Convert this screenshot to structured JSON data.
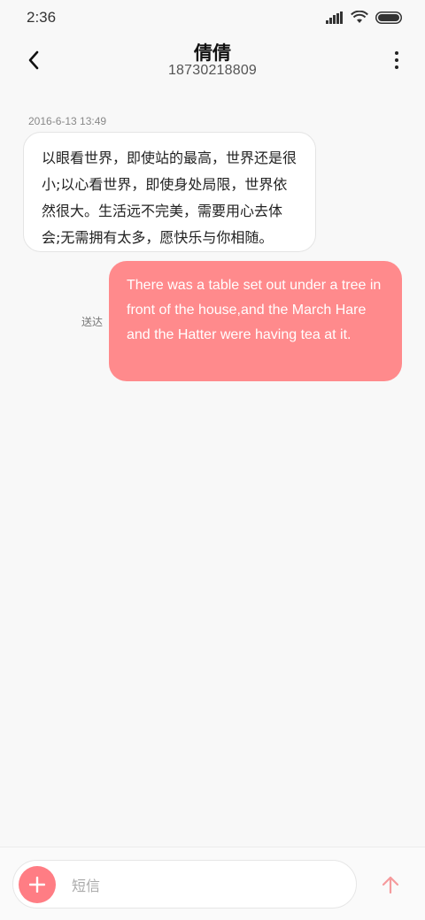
{
  "status": {
    "time": "2:36"
  },
  "header": {
    "name": "倩倩",
    "number": "18730218809"
  },
  "messages": {
    "timestamp": "2016-6-13 13:49",
    "incoming_text": "以眼看世界，即使站的最高，世界还是很小;以心看世界，即使身处局限，世界依然很大。生活远不完美，需要用心去体会;无需拥有太多，愿快乐与你相随。",
    "delivered_label": "送达",
    "outgoing_text": "There was a table set out under a tree in front of the house,and the March Hare and the Hatter were having tea at it."
  },
  "composer": {
    "placeholder": "短信"
  },
  "colors": {
    "accent": "#ff7d84",
    "outgoing_bubble": "#ff8a8c",
    "send_arrow": "#f59a9c"
  },
  "icons": [
    "signal-icon",
    "wifi-icon",
    "battery-icon",
    "back-arrow-icon",
    "more-vert-icon",
    "plus-icon",
    "send-arrow-icon"
  ]
}
